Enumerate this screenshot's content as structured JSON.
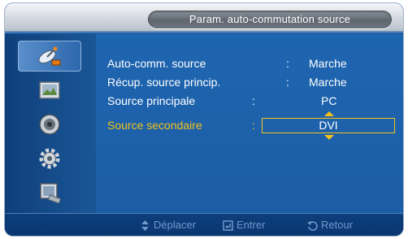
{
  "header": {
    "title": "Param. auto-commutation source"
  },
  "sidebar": {
    "items": [
      {
        "icon": "satellite-dish-icon",
        "active": true
      },
      {
        "icon": "picture-icon",
        "active": false
      },
      {
        "icon": "sound-speaker-icon",
        "active": false
      },
      {
        "icon": "gear-icon",
        "active": false
      },
      {
        "icon": "multi-display-icon",
        "active": false
      }
    ]
  },
  "menu": {
    "rows": [
      {
        "label": "Auto-comm. source",
        "colon": ":",
        "value": "Marche"
      },
      {
        "label": "Récup. source princip.",
        "colon": ":",
        "value": "Marche"
      },
      {
        "label": "Source principale",
        "colon": ":",
        "value": "PC"
      },
      {
        "label": "Source secondaire",
        "colon": ":",
        "value": "DVI"
      }
    ]
  },
  "footer": {
    "move_label": "Déplacer",
    "enter_label": "Entrer",
    "return_label": "Retour"
  },
  "colors": {
    "highlight": "#f2c21a",
    "menu_bg": "#1c5fa8",
    "footer_text": "#6f97c9"
  }
}
